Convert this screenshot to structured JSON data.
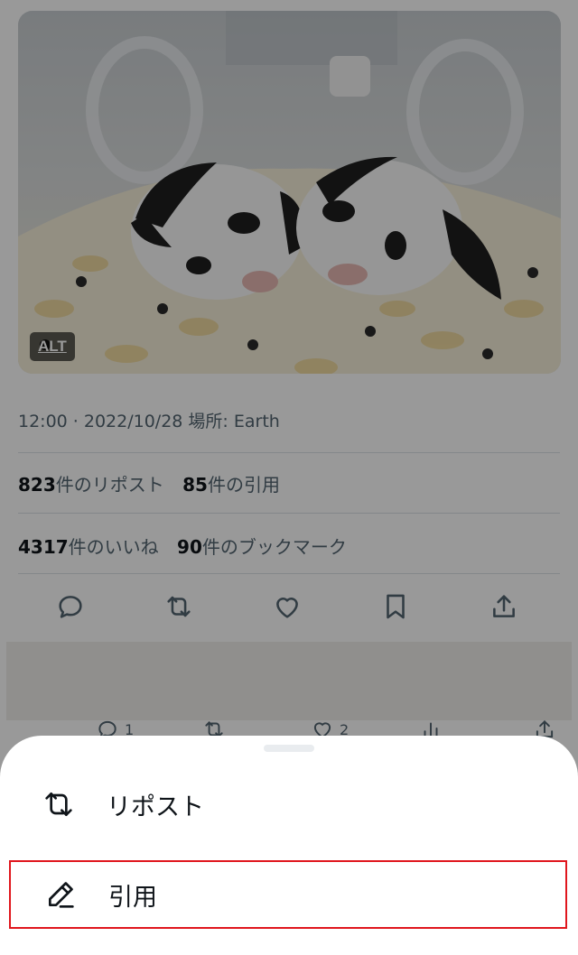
{
  "media": {
    "alt_badge": "ALT"
  },
  "tweet": {
    "meta_line": "12:00 · 2022/10/28 場所: Earth",
    "stats_row1": [
      {
        "count": "823",
        "label": "件のリポスト"
      },
      {
        "count": "85",
        "label": "件の引用"
      }
    ],
    "stats_row2": [
      {
        "count": "4317",
        "label": "件のいいね"
      },
      {
        "count": "90",
        "label": "件のブックマーク"
      }
    ],
    "action_icons": [
      "reply-icon",
      "repost-icon",
      "like-icon",
      "bookmark-icon",
      "share-icon"
    ]
  },
  "next_tweet": {
    "reply_count": "1",
    "like_count": "2"
  },
  "sheet": {
    "items": [
      {
        "icon": "repost-icon",
        "label": "リポスト"
      },
      {
        "icon": "quote-pen-icon",
        "label": "引用"
      }
    ]
  },
  "colors": {
    "highlight_border": "#e0161d",
    "text_secondary": "#536471",
    "text_primary": "#0f1419"
  }
}
